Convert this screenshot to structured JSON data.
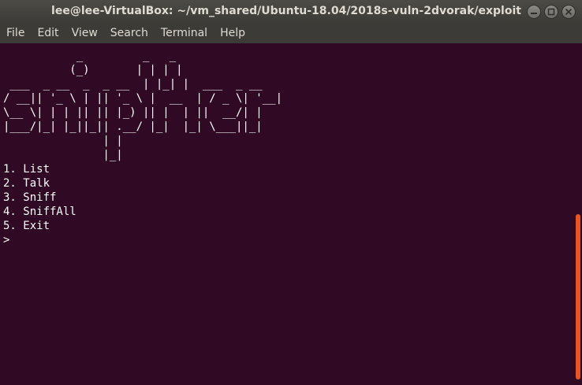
{
  "window": {
    "title": "lee@lee-VirtualBox: ~/vm_shared/Ubuntu-18.04/2018s-vuln-2dvorak/exploit"
  },
  "menu": {
    "file": "File",
    "edit": "Edit",
    "view": "View",
    "search": "Search",
    "terminal": "Terminal",
    "help": "Help"
  },
  "terminal": {
    "banner": [
      "           _         _   _ ",
      "          (_)       | | | |",
      " ___  _ __  _  _ __  | |_| |  ___  _ __",
      "/ __|| '_ \\ | || '_ \\ |  __  | / _ \\| '__|",
      "\\__ \\| | | || || |_) || |  | ||  __/| |",
      "|___/|_| |_||_|| .__/ |_|  |_| \\___||_|",
      "               | |",
      "               |_|"
    ],
    "menu_items": [
      "1. List",
      "2. Talk",
      "3. Sniff",
      "4. SniffAll",
      "5. Exit"
    ],
    "prompt": ">"
  },
  "colors": {
    "background": "#300a24",
    "titlebar": "#3c3b37",
    "scrollbar_thumb": "#e95420",
    "text": "#ffffff"
  }
}
